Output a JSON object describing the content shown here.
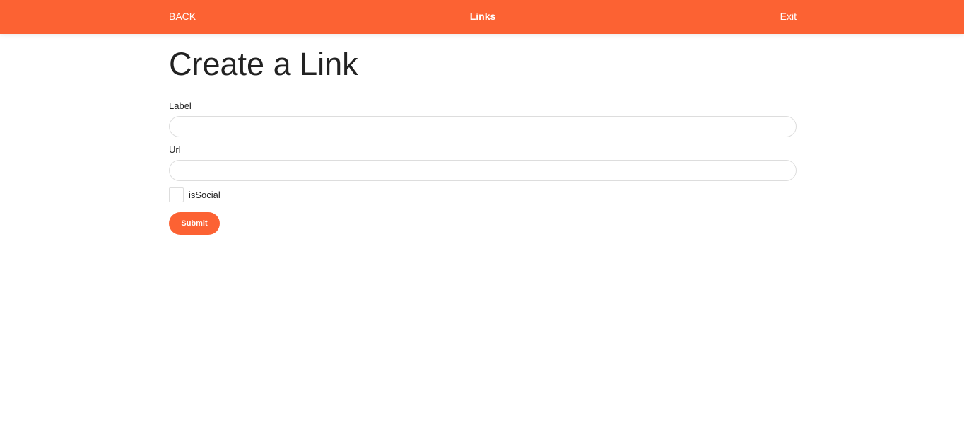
{
  "header": {
    "back_label": "BACK",
    "title": "Links",
    "exit_label": "Exit",
    "color": "#fc6233"
  },
  "form": {
    "title": "Create a Link",
    "label_field": {
      "label": "Label",
      "value": "",
      "placeholder": ""
    },
    "url_field": {
      "label": "Url",
      "value": "",
      "placeholder": ""
    },
    "is_social": {
      "label": "isSocial",
      "checked": false
    },
    "submit_label": "Submit"
  }
}
